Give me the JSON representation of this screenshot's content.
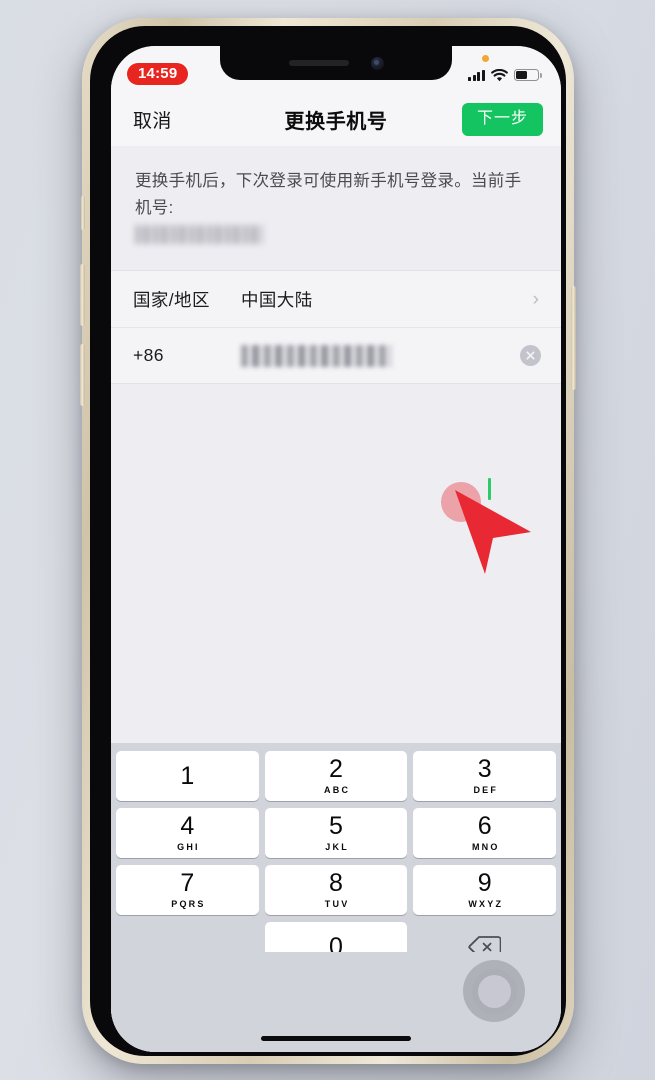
{
  "device": {
    "frame_color": "#d8cdb4",
    "bezel_color": "#09090b",
    "screen_bg": "#eeeef2"
  },
  "status_bar": {
    "time": "14:59",
    "time_badge_color": "#e8251f",
    "privacy_dot_color": "#f0a830",
    "signal_icon": "cellular-signal-icon",
    "wifi_icon": "wifi-icon",
    "battery_icon": "battery-icon",
    "battery_level_percent": 52
  },
  "nav_bar": {
    "cancel_label": "取消",
    "title": "更换手机号",
    "next_label": "下一步",
    "next_button_color": "#14c460"
  },
  "content": {
    "description": "更换手机后，下次登录可使用新手机号登录。当前手机号:",
    "current_phone_masked": "",
    "rows": [
      {
        "label": "国家/地区",
        "value": "中国大陆",
        "accessory": "chevron-right-icon"
      }
    ],
    "phone_input": {
      "country_code": "+86",
      "value_masked": "",
      "caret_color": "#2fc96a",
      "clear_icon": "clear-circle-icon"
    }
  },
  "cursor": {
    "type": "arrow-cursor",
    "color": "#e82832",
    "tap_ring_color": "rgba(232,40,50,0.38)"
  },
  "keyboard": {
    "background": "#d2d4db",
    "rows": [
      [
        {
          "num": "1",
          "sub": ""
        },
        {
          "num": "2",
          "sub": "ABC"
        },
        {
          "num": "3",
          "sub": "DEF"
        }
      ],
      [
        {
          "num": "4",
          "sub": "GHI"
        },
        {
          "num": "5",
          "sub": "JKL"
        },
        {
          "num": "6",
          "sub": "MNO"
        }
      ],
      [
        {
          "num": "7",
          "sub": "PQRS"
        },
        {
          "num": "8",
          "sub": "TUV"
        },
        {
          "num": "9",
          "sub": "WXYZ"
        }
      ]
    ],
    "zero_key": {
      "num": "0",
      "sub": ""
    },
    "delete_icon": "backspace-delete-icon"
  },
  "home_area": {
    "home_indicator": "home-indicator-bar",
    "assistive_touch": "assistive-touch-button"
  }
}
